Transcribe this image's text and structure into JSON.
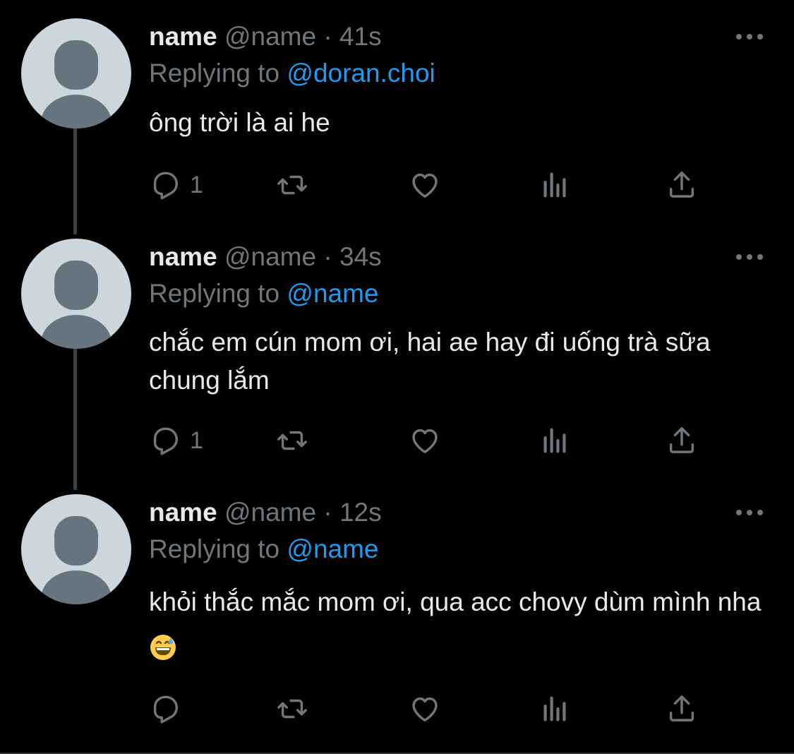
{
  "tweets": [
    {
      "display_name": "name",
      "handle": "@name",
      "separator": "·",
      "time": "41s",
      "replying_prefix": "Replying to ",
      "replying_to": "@doran.choi",
      "body": "ông trời là ai he",
      "reply_count": "1"
    },
    {
      "display_name": "name",
      "handle": "@name",
      "separator": "·",
      "time": "34s",
      "replying_prefix": "Replying to ",
      "replying_to": "@name",
      "body": "chắc em cún mom ơi, hai ae hay đi uống trà sữa chung lắm",
      "reply_count": "1"
    },
    {
      "display_name": "name",
      "handle": "@name",
      "separator": "·",
      "time": "12s",
      "replying_prefix": "Replying to ",
      "replying_to": "@name",
      "body": "khỏi thắc mắc mom ơi, qua acc chovy dùm mình nha",
      "emoji": "grinning-sweat-emoji",
      "reply_count": ""
    }
  ],
  "icons": {
    "reply": "reply-icon",
    "retweet": "retweet-icon",
    "like": "heart-icon",
    "views": "analytics-icon",
    "share": "share-icon",
    "more": "more-icon"
  },
  "colors": {
    "background": "#000000",
    "primary_text": "#e7e9ea",
    "secondary_text": "#71767b",
    "accent": "#1d9bf0",
    "thread_line": "#3b4043",
    "avatar_bg": "#ccd6dd",
    "avatar_fg": "#66757f"
  }
}
